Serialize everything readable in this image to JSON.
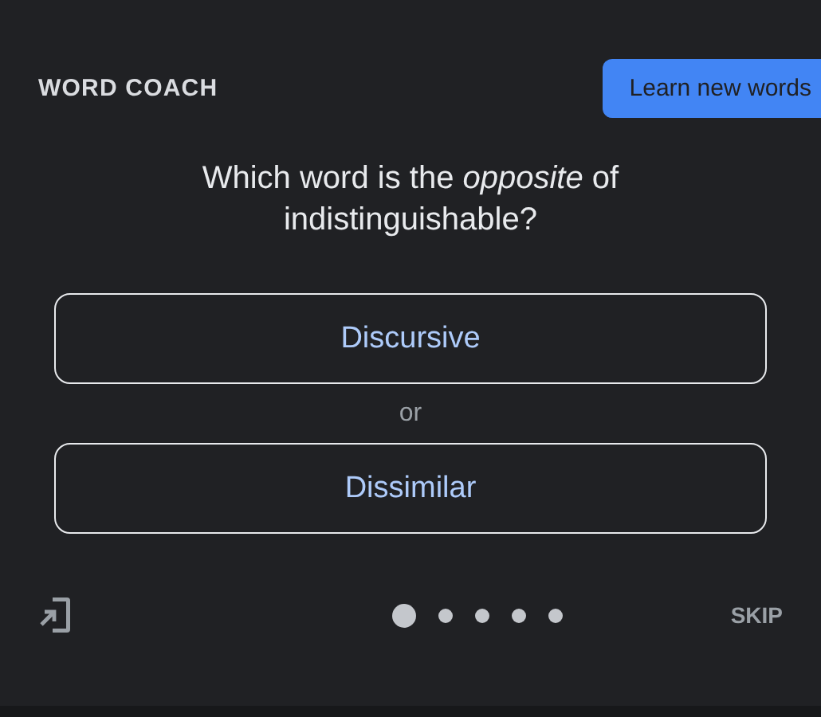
{
  "header": {
    "title": "WORD COACH",
    "action": "Learn new words"
  },
  "question": "Which word is the *opposite* of indistinguishable?",
  "options": [
    {
      "label": "Discursive"
    },
    {
      "label": "Dissimilar"
    }
  ],
  "separator": "or",
  "pagination": [
    {
      "selected": true
    },
    {
      "selected": false
    },
    {
      "selected": false
    },
    {
      "selected": false
    },
    {
      "selected": false
    }
  ],
  "skip": "SKIP"
}
